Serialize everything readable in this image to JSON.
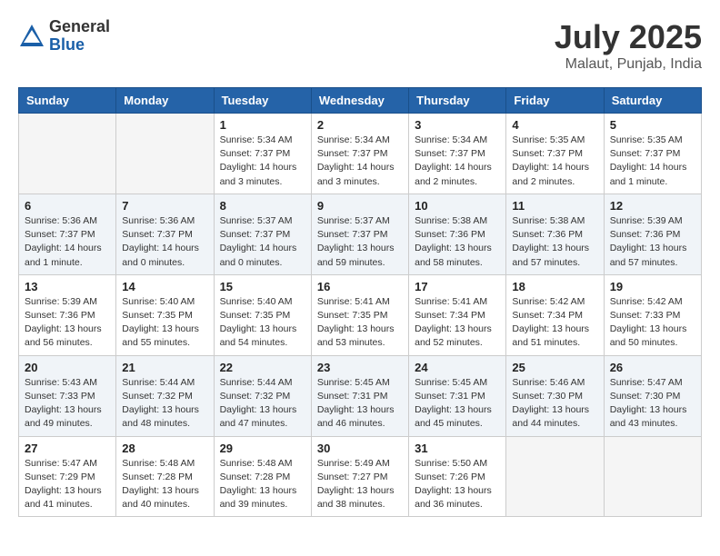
{
  "header": {
    "logo_general": "General",
    "logo_blue": "Blue",
    "month_title": "July 2025",
    "location": "Malaut, Punjab, India"
  },
  "days_of_week": [
    "Sunday",
    "Monday",
    "Tuesday",
    "Wednesday",
    "Thursday",
    "Friday",
    "Saturday"
  ],
  "weeks": [
    [
      {
        "day": "",
        "info": ""
      },
      {
        "day": "",
        "info": ""
      },
      {
        "day": "1",
        "info": "Sunrise: 5:34 AM\nSunset: 7:37 PM\nDaylight: 14 hours and 3 minutes."
      },
      {
        "day": "2",
        "info": "Sunrise: 5:34 AM\nSunset: 7:37 PM\nDaylight: 14 hours and 3 minutes."
      },
      {
        "day": "3",
        "info": "Sunrise: 5:34 AM\nSunset: 7:37 PM\nDaylight: 14 hours and 2 minutes."
      },
      {
        "day": "4",
        "info": "Sunrise: 5:35 AM\nSunset: 7:37 PM\nDaylight: 14 hours and 2 minutes."
      },
      {
        "day": "5",
        "info": "Sunrise: 5:35 AM\nSunset: 7:37 PM\nDaylight: 14 hours and 1 minute."
      }
    ],
    [
      {
        "day": "6",
        "info": "Sunrise: 5:36 AM\nSunset: 7:37 PM\nDaylight: 14 hours and 1 minute."
      },
      {
        "day": "7",
        "info": "Sunrise: 5:36 AM\nSunset: 7:37 PM\nDaylight: 14 hours and 0 minutes."
      },
      {
        "day": "8",
        "info": "Sunrise: 5:37 AM\nSunset: 7:37 PM\nDaylight: 14 hours and 0 minutes."
      },
      {
        "day": "9",
        "info": "Sunrise: 5:37 AM\nSunset: 7:37 PM\nDaylight: 13 hours and 59 minutes."
      },
      {
        "day": "10",
        "info": "Sunrise: 5:38 AM\nSunset: 7:36 PM\nDaylight: 13 hours and 58 minutes."
      },
      {
        "day": "11",
        "info": "Sunrise: 5:38 AM\nSunset: 7:36 PM\nDaylight: 13 hours and 57 minutes."
      },
      {
        "day": "12",
        "info": "Sunrise: 5:39 AM\nSunset: 7:36 PM\nDaylight: 13 hours and 57 minutes."
      }
    ],
    [
      {
        "day": "13",
        "info": "Sunrise: 5:39 AM\nSunset: 7:36 PM\nDaylight: 13 hours and 56 minutes."
      },
      {
        "day": "14",
        "info": "Sunrise: 5:40 AM\nSunset: 7:35 PM\nDaylight: 13 hours and 55 minutes."
      },
      {
        "day": "15",
        "info": "Sunrise: 5:40 AM\nSunset: 7:35 PM\nDaylight: 13 hours and 54 minutes."
      },
      {
        "day": "16",
        "info": "Sunrise: 5:41 AM\nSunset: 7:35 PM\nDaylight: 13 hours and 53 minutes."
      },
      {
        "day": "17",
        "info": "Sunrise: 5:41 AM\nSunset: 7:34 PM\nDaylight: 13 hours and 52 minutes."
      },
      {
        "day": "18",
        "info": "Sunrise: 5:42 AM\nSunset: 7:34 PM\nDaylight: 13 hours and 51 minutes."
      },
      {
        "day": "19",
        "info": "Sunrise: 5:42 AM\nSunset: 7:33 PM\nDaylight: 13 hours and 50 minutes."
      }
    ],
    [
      {
        "day": "20",
        "info": "Sunrise: 5:43 AM\nSunset: 7:33 PM\nDaylight: 13 hours and 49 minutes."
      },
      {
        "day": "21",
        "info": "Sunrise: 5:44 AM\nSunset: 7:32 PM\nDaylight: 13 hours and 48 minutes."
      },
      {
        "day": "22",
        "info": "Sunrise: 5:44 AM\nSunset: 7:32 PM\nDaylight: 13 hours and 47 minutes."
      },
      {
        "day": "23",
        "info": "Sunrise: 5:45 AM\nSunset: 7:31 PM\nDaylight: 13 hours and 46 minutes."
      },
      {
        "day": "24",
        "info": "Sunrise: 5:45 AM\nSunset: 7:31 PM\nDaylight: 13 hours and 45 minutes."
      },
      {
        "day": "25",
        "info": "Sunrise: 5:46 AM\nSunset: 7:30 PM\nDaylight: 13 hours and 44 minutes."
      },
      {
        "day": "26",
        "info": "Sunrise: 5:47 AM\nSunset: 7:30 PM\nDaylight: 13 hours and 43 minutes."
      }
    ],
    [
      {
        "day": "27",
        "info": "Sunrise: 5:47 AM\nSunset: 7:29 PM\nDaylight: 13 hours and 41 minutes."
      },
      {
        "day": "28",
        "info": "Sunrise: 5:48 AM\nSunset: 7:28 PM\nDaylight: 13 hours and 40 minutes."
      },
      {
        "day": "29",
        "info": "Sunrise: 5:48 AM\nSunset: 7:28 PM\nDaylight: 13 hours and 39 minutes."
      },
      {
        "day": "30",
        "info": "Sunrise: 5:49 AM\nSunset: 7:27 PM\nDaylight: 13 hours and 38 minutes."
      },
      {
        "day": "31",
        "info": "Sunrise: 5:50 AM\nSunset: 7:26 PM\nDaylight: 13 hours and 36 minutes."
      },
      {
        "day": "",
        "info": ""
      },
      {
        "day": "",
        "info": ""
      }
    ]
  ]
}
